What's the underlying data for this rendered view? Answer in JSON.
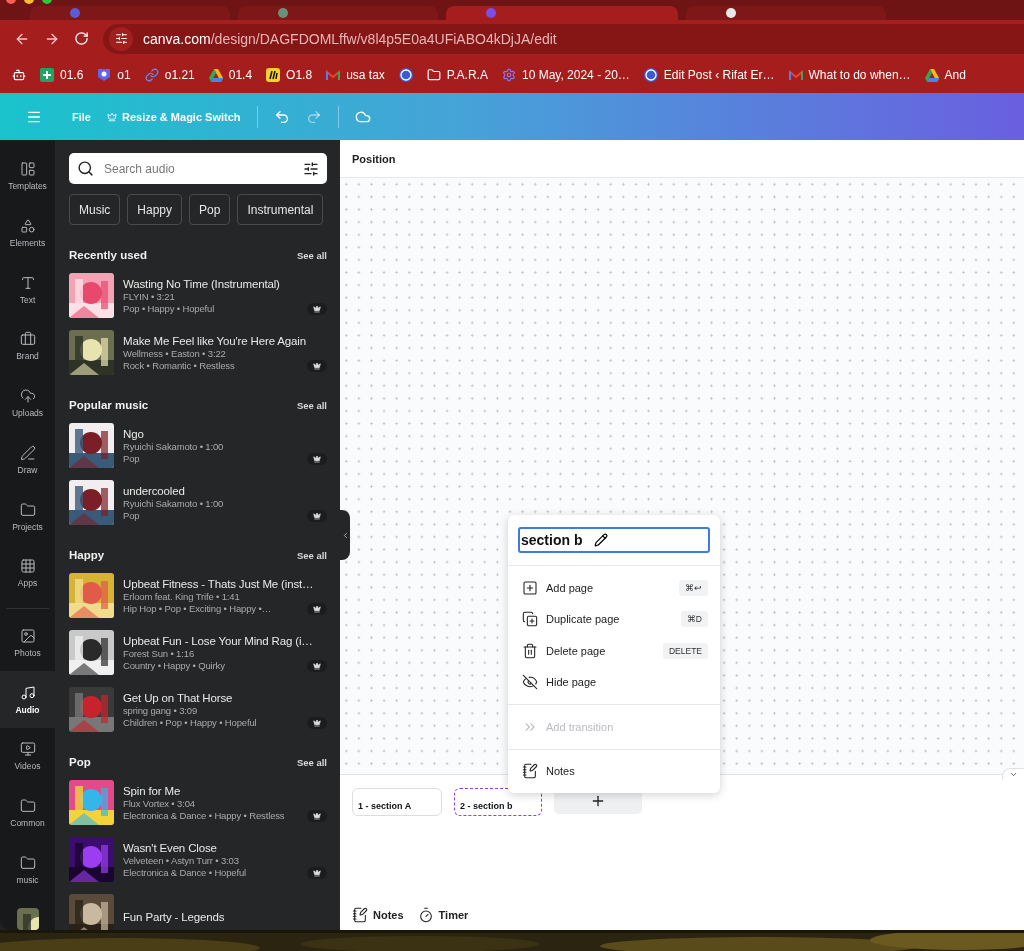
{
  "address_bar": {
    "domain": "canva.com",
    "path": "/design/DAGFDOMLffw/v8l4p5E0a4UFiABO4kDjJA/edit"
  },
  "bookmarks": [
    {
      "kind": "chat"
    },
    {
      "kind": "sheets",
      "label": "01.6"
    },
    {
      "kind": "badge",
      "label": "o1"
    },
    {
      "kind": "link",
      "label": "o1.21"
    },
    {
      "kind": "drive",
      "label": "01.4"
    },
    {
      "kind": "miro",
      "label": "O1.8"
    },
    {
      "kind": "gmail",
      "label": "usa tax"
    },
    {
      "kind": "wordpress"
    },
    {
      "kind": "folder",
      "label": "P.A.R.A"
    },
    {
      "kind": "gear",
      "label": "10 May, 2024 - 20…"
    },
    {
      "kind": "wordpress",
      "label": "Edit Post ‹ Rifat Er…"
    },
    {
      "kind": "gmail",
      "label": "What to do when…"
    },
    {
      "kind": "drive",
      "label": "And"
    }
  ],
  "toolbar": {
    "file": "File",
    "resize": "Resize & Magic Switch"
  },
  "rail": [
    {
      "kind": "templates",
      "label": "Templates",
      "selected": false
    },
    {
      "kind": "elements",
      "label": "Elements",
      "selected": false
    },
    {
      "kind": "text",
      "label": "Text",
      "selected": false
    },
    {
      "kind": "brand",
      "label": "Brand",
      "selected": false
    },
    {
      "kind": "uploads",
      "label": "Uploads",
      "selected": false
    },
    {
      "kind": "draw",
      "label": "Draw",
      "selected": false
    },
    {
      "kind": "folder",
      "label": "Projects",
      "selected": false
    },
    {
      "kind": "apps",
      "label": "Apps",
      "selected": false
    },
    {
      "kind": "photos",
      "label": "Photos",
      "selected": false
    },
    {
      "kind": "audio",
      "label": "Audio",
      "selected": true
    },
    {
      "kind": "videos",
      "label": "Videos",
      "selected": false
    },
    {
      "kind": "folder",
      "label": "Common",
      "selected": false
    },
    {
      "kind": "folder",
      "label": "music",
      "selected": false
    }
  ],
  "search": {
    "placeholder": "Search audio"
  },
  "chips": [
    "Music",
    "Happy",
    "Pop",
    "Instrumental"
  ],
  "sections": [
    {
      "title": "Recently used",
      "see_all": "See all",
      "tracks": [
        {
          "title": "Wasting No Time (Instrumental)",
          "meta": "FLYIN • 3:21",
          "tags": "Pop • Happy • Hopeful"
        },
        {
          "title": "Make Me Feel like You're Here Again",
          "meta": "Wellmess • Easton • 3:22",
          "tags": "Rock • Romantic • Restless"
        }
      ]
    },
    {
      "title": "Popular music",
      "see_all": "See all",
      "tracks": [
        {
          "title": "Ngo",
          "meta": "Ryuichi Sakamoto • 1:00",
          "tags": "Pop"
        },
        {
          "title": "undercooled",
          "meta": "Ryuichi Sakamoto • 1:00",
          "tags": "Pop"
        }
      ]
    },
    {
      "title": "Happy",
      "see_all": "See all",
      "tracks": [
        {
          "title": "Upbeat Fitness - Thats Just Me (inst…",
          "meta": "Erloom feat. King Trife • 1:41",
          "tags": "Hip Hop • Pop • Exciting • Happy •…"
        },
        {
          "title": "Upbeat Fun - Lose Your Mind Rag (i…",
          "meta": "Forest Sun • 1:16",
          "tags": "Country • Happy • Quirky"
        },
        {
          "title": "Get Up on That Horse",
          "meta": "spring gang • 3:09",
          "tags": "Children • Pop • Happy • Hopeful"
        }
      ]
    },
    {
      "title": "Pop",
      "see_all": "See all",
      "tracks": [
        {
          "title": "Spin for Me",
          "meta": "Flux Vortex • 3:04",
          "tags": "Electronica & Dance • Happy • Restless"
        },
        {
          "title": "Wasn't Even Close",
          "meta": "Velveteen • Astyn Turr • 3:03",
          "tags": "Electronica & Dance • Hopeful"
        },
        {
          "title": "Fun Party - Legends"
        }
      ]
    }
  ],
  "canvas": {
    "header": "Position"
  },
  "context_menu": {
    "page_name": "section b",
    "groups": [
      [
        {
          "kind": "add",
          "label": "Add page",
          "shortcut": "⌘↩",
          "disabled": false
        },
        {
          "kind": "duplicate",
          "label": "Duplicate page",
          "shortcut": "⌘D",
          "disabled": false
        },
        {
          "kind": "delete",
          "label": "Delete page",
          "shortcut": "DELETE",
          "disabled": false
        },
        {
          "kind": "hide",
          "label": "Hide page",
          "disabled": false
        }
      ],
      [
        {
          "kind": "transition",
          "label": "Add transition",
          "disabled": true
        }
      ],
      [
        {
          "kind": "notes",
          "label": "Notes",
          "disabled": false
        }
      ]
    ]
  },
  "pages": [
    {
      "label": "1 - section A",
      "selected": false
    },
    {
      "label": "2 - section b",
      "selected": true
    }
  ],
  "footer": [
    {
      "kind": "notes",
      "label": "Notes"
    },
    {
      "kind": "timer",
      "label": "Timer"
    }
  ]
}
